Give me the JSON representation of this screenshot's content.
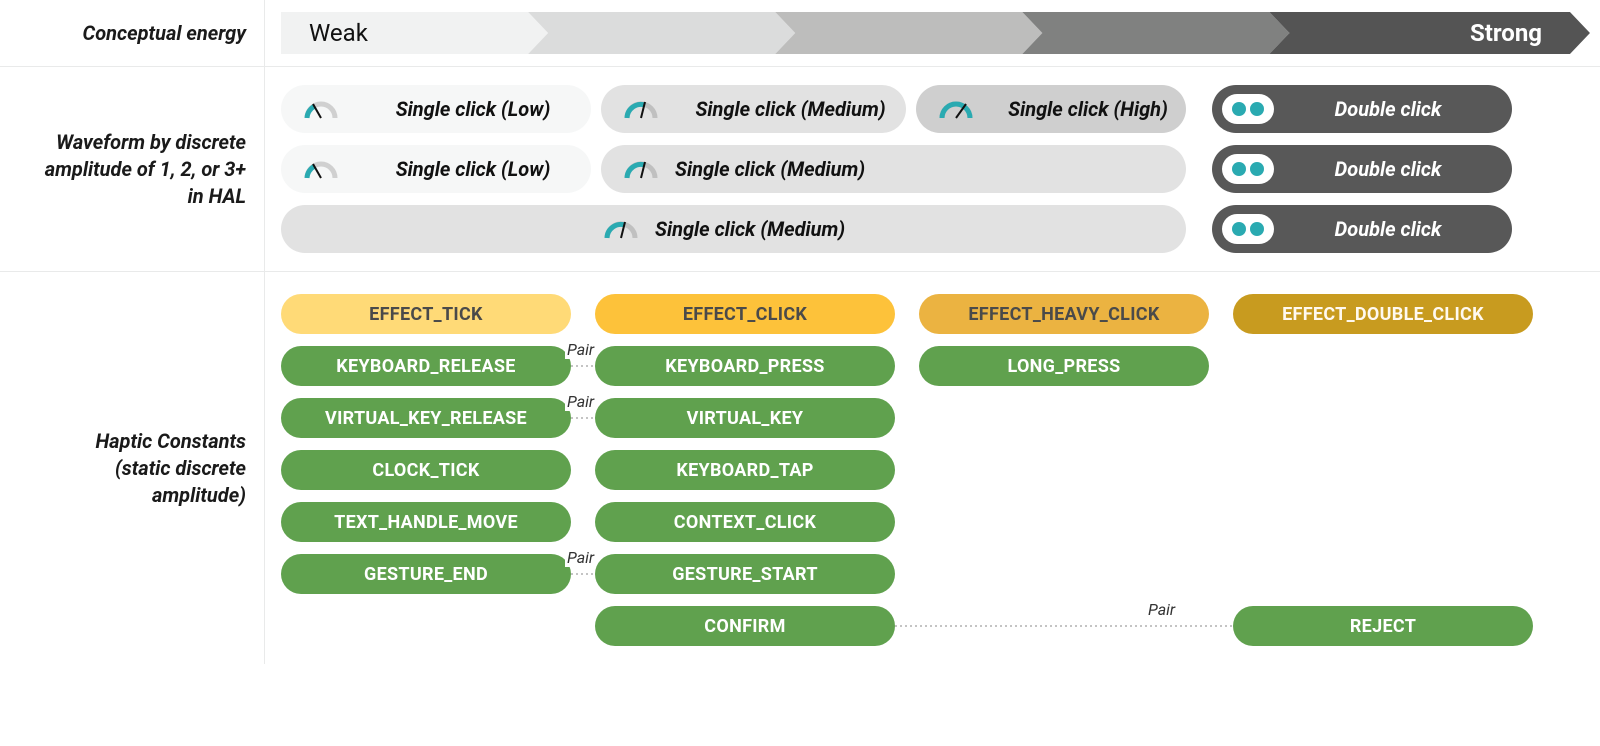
{
  "row_labels": {
    "energy": "Conceptual energy",
    "waveform": "Waveform by discrete amplitude of 1, 2, or 3+ in HAL",
    "constants_l1": "Haptic Constants",
    "constants_l2": "(static discrete amplitude)"
  },
  "energy_axis": {
    "left": "Weak",
    "right": "Strong"
  },
  "waveform": {
    "single_low": "Single click (Low)",
    "single_med": "Single click (Medium)",
    "single_high": "Single click (High)",
    "double": "Double click"
  },
  "effect_chips": {
    "tick": "EFFECT_TICK",
    "click": "EFFECT_CLICK",
    "heavy": "EFFECT_HEAVY_CLICK",
    "dclick": "EFFECT_DOUBLE_CLICK"
  },
  "pair_label": "Pair",
  "green": {
    "c1": [
      "KEYBOARD_RELEASE",
      "VIRTUAL_KEY_RELEASE",
      "CLOCK_TICK",
      "TEXT_HANDLE_MOVE",
      "GESTURE_END"
    ],
    "c2": [
      "KEYBOARD_PRESS",
      "VIRTUAL_KEY",
      "KEYBOARD_TAP",
      "CONTEXT_CLICK",
      "GESTURE_START",
      "CONFIRM"
    ],
    "c3": [
      "LONG_PRESS"
    ],
    "c4": [
      "REJECT"
    ]
  },
  "constants_grid_rows": [
    {
      "c1": "KEYBOARD_RELEASE",
      "c2": "KEYBOARD_PRESS",
      "c3": "LONG_PRESS",
      "c4": "",
      "pair_c1c2": true
    },
    {
      "c1": "VIRTUAL_KEY_RELEASE",
      "c2": "VIRTUAL_KEY",
      "c3": "",
      "c4": "",
      "pair_c1c2": true
    },
    {
      "c1": "CLOCK_TICK",
      "c2": "KEYBOARD_TAP",
      "c3": "",
      "c4": "",
      "pair_c1c2": false
    },
    {
      "c1": "TEXT_HANDLE_MOVE",
      "c2": "CONTEXT_CLICK",
      "c3": "",
      "c4": "",
      "pair_c1c2": false
    },
    {
      "c1": "GESTURE_END",
      "c2": "GESTURE_START",
      "c3": "",
      "c4": "",
      "pair_c1c2": true
    },
    {
      "c1": "",
      "c2": "CONFIRM",
      "c3": "",
      "c4": "REJECT",
      "pair_c2c4": true
    }
  ],
  "colors": {
    "green": "#60a14e",
    "yellow1": "#ffda77",
    "yellow2": "#fdc23a",
    "yellow3": "#ebb341",
    "gold": "#c89b1f",
    "teal": "#2aaab1",
    "dark_pill": "#585858"
  },
  "chart_data": {
    "type": "table",
    "title": "Haptic strength mapping",
    "axis": {
      "label": "Conceptual energy",
      "from": "Weak",
      "to": "Strong"
    },
    "columns": [
      "EFFECT_TICK",
      "EFFECT_CLICK",
      "EFFECT_HEAVY_CLICK",
      "EFFECT_DOUBLE_CLICK"
    ],
    "haptic_constants": {
      "EFFECT_TICK": [
        "KEYBOARD_RELEASE",
        "VIRTUAL_KEY_RELEASE",
        "CLOCK_TICK",
        "TEXT_HANDLE_MOVE",
        "GESTURE_END"
      ],
      "EFFECT_CLICK": [
        "KEYBOARD_PRESS",
        "VIRTUAL_KEY",
        "KEYBOARD_TAP",
        "CONTEXT_CLICK",
        "GESTURE_START",
        "CONFIRM"
      ],
      "EFFECT_HEAVY_CLICK": [
        "LONG_PRESS"
      ],
      "EFFECT_DOUBLE_CLICK": [
        "REJECT"
      ]
    },
    "pairs": [
      [
        "KEYBOARD_RELEASE",
        "KEYBOARD_PRESS"
      ],
      [
        "VIRTUAL_KEY_RELEASE",
        "VIRTUAL_KEY"
      ],
      [
        "GESTURE_END",
        "GESTURE_START"
      ],
      [
        "CONFIRM",
        "REJECT"
      ]
    ],
    "waveform_amplitude_rows": [
      {
        "amplitude": 3,
        "tick": "Single click (Low)",
        "click": "Single click (Medium)",
        "heavy": "Single click (High)",
        "dclick": "Double click"
      },
      {
        "amplitude": 2,
        "tick": "Single click (Low)",
        "click": "Single click (Medium)",
        "heavy": "Single click (Medium)",
        "dclick": "Double click"
      },
      {
        "amplitude": 1,
        "tick": "Single click (Medium)",
        "click": "Single click (Medium)",
        "heavy": "Single click (Medium)",
        "dclick": "Double click"
      }
    ]
  }
}
